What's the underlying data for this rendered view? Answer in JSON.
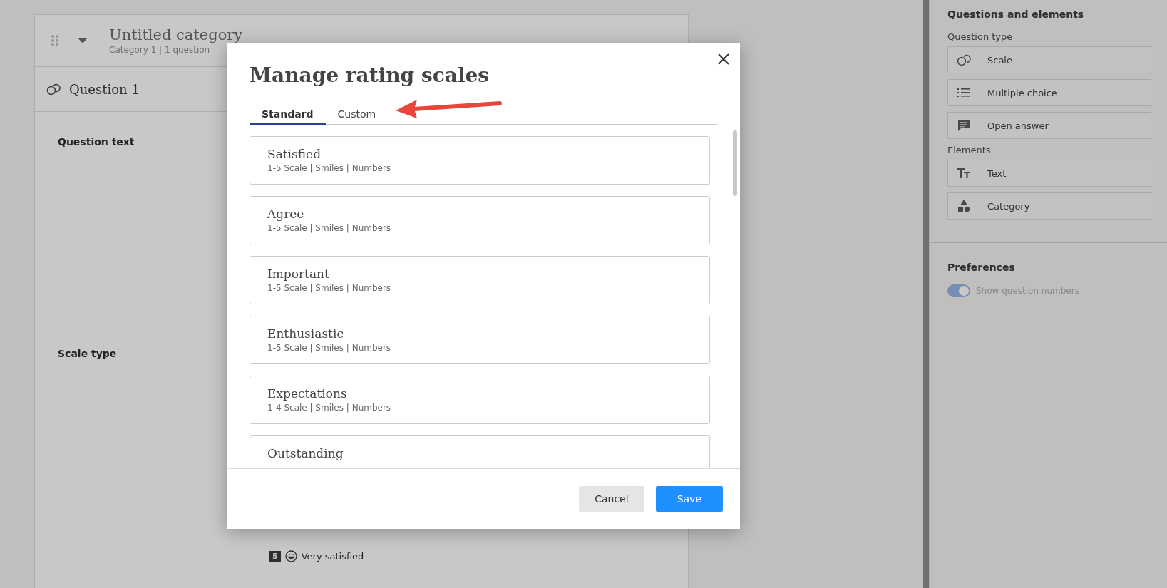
{
  "editor": {
    "category": {
      "title": "Untitled category",
      "subtitle": "Category 1 | 1 question"
    },
    "question": {
      "title": "Question 1"
    },
    "sections": [
      {
        "label": "Question text"
      },
      {
        "label": "Scale type"
      }
    ],
    "scale_option": {
      "number": "5",
      "label": "Very satisfied"
    }
  },
  "sidebar": {
    "title": "Questions and elements",
    "groups": [
      {
        "label": "Question type",
        "items": [
          {
            "label": "Scale",
            "kind": "scale"
          },
          {
            "label": "Multiple choice",
            "kind": "list"
          },
          {
            "label": "Open answer",
            "kind": "comment"
          }
        ]
      },
      {
        "label": "Elements",
        "items": [
          {
            "label": "Text",
            "kind": "text"
          },
          {
            "label": "Category",
            "kind": "shapes"
          }
        ]
      }
    ],
    "preferences": {
      "title": "Preferences",
      "toggle": {
        "label": "Show question numbers",
        "on": true
      }
    }
  },
  "dialog": {
    "title": "Manage rating scales",
    "tabs": [
      {
        "label": "Standard",
        "selected": true
      },
      {
        "label": "Custom",
        "selected": false
      }
    ],
    "scales": [
      {
        "name": "Satisfied",
        "details": "1-5 Scale | Smiles | Numbers"
      },
      {
        "name": "Agree",
        "details": "1-5 Scale | Smiles | Numbers"
      },
      {
        "name": "Important",
        "details": "1-5 Scale | Smiles | Numbers"
      },
      {
        "name": "Enthusiastic",
        "details": "1-5 Scale | Smiles | Numbers"
      },
      {
        "name": "Expectations",
        "details": "1-4 Scale | Smiles | Numbers"
      },
      {
        "name": "Outstanding"
      }
    ],
    "buttons": [
      {
        "label": "Cancel",
        "kind": "secondary"
      },
      {
        "label": "Save",
        "kind": "primary"
      }
    ]
  }
}
